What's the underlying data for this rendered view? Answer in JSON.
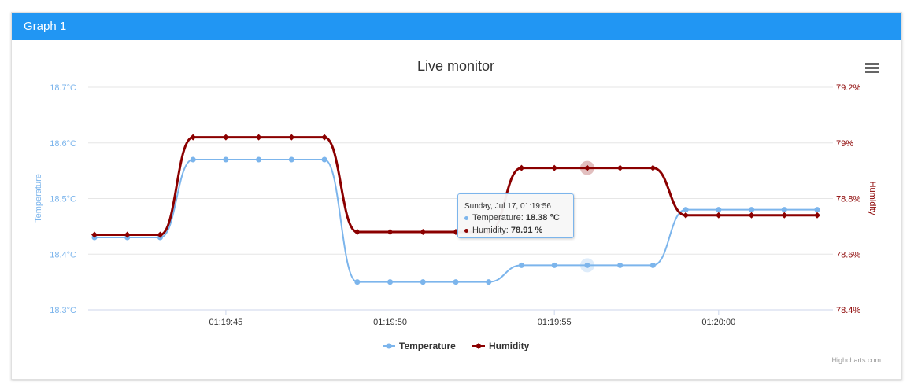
{
  "panel": {
    "title": "Graph 1"
  },
  "colors": {
    "header": "#2196f3",
    "temperature": "#7cb5ec",
    "humidity": "#8b0000"
  },
  "tooltip": {
    "header": "Sunday, Jul 17, 01:19:56",
    "temp_label": "Temperature: ",
    "temp_value": "18.38 °C",
    "hum_label": "Humidity: ",
    "hum_value": "78.91 %"
  },
  "credits": "Highcharts.com",
  "chart_data": {
    "type": "line",
    "title": "Live monitor",
    "x": [
      "01:19:41",
      "01:19:42",
      "01:19:43",
      "01:19:44",
      "01:19:45",
      "01:19:46",
      "01:19:47",
      "01:19:48",
      "01:19:49",
      "01:19:50",
      "01:19:51",
      "01:19:52",
      "01:19:53",
      "01:19:54",
      "01:19:55",
      "01:19:56",
      "01:19:57",
      "01:19:58",
      "01:19:59",
      "01:20:00",
      "01:20:01",
      "01:20:02",
      "01:20:03"
    ],
    "xticks": [
      "01:19:45",
      "01:19:50",
      "01:19:55",
      "01:20:00"
    ],
    "series": [
      {
        "name": "Temperature",
        "axis": "left",
        "unit": "°C",
        "smooth": true,
        "values": [
          18.43,
          18.43,
          18.43,
          18.57,
          18.57,
          18.57,
          18.57,
          18.57,
          18.35,
          18.35,
          18.35,
          18.35,
          18.35,
          18.38,
          18.38,
          18.38,
          18.38,
          18.38,
          18.48,
          18.48,
          18.48,
          18.48,
          18.48
        ]
      },
      {
        "name": "Humidity",
        "axis": "right",
        "unit": "%",
        "smooth": true,
        "values": [
          78.67,
          78.67,
          78.67,
          79.02,
          79.02,
          79.02,
          79.02,
          79.02,
          78.68,
          78.68,
          78.68,
          78.68,
          78.68,
          78.91,
          78.91,
          78.91,
          78.91,
          78.91,
          78.74,
          78.74,
          78.74,
          78.74,
          78.74
        ]
      }
    ],
    "y_left": {
      "label": "Temperature",
      "ylim": [
        18.3,
        18.7
      ],
      "ticks": [
        "18.3°C",
        "18.4°C",
        "18.5°C",
        "18.6°C",
        "18.7°C"
      ]
    },
    "y_right": {
      "label": "Humidity",
      "ylim": [
        78.4,
        79.2
      ],
      "ticks": [
        "78.4%",
        "78.6%",
        "78.8%",
        "79%",
        "79.2%"
      ]
    },
    "grid": true,
    "legend": "bottom-center",
    "hover_index": 15
  }
}
